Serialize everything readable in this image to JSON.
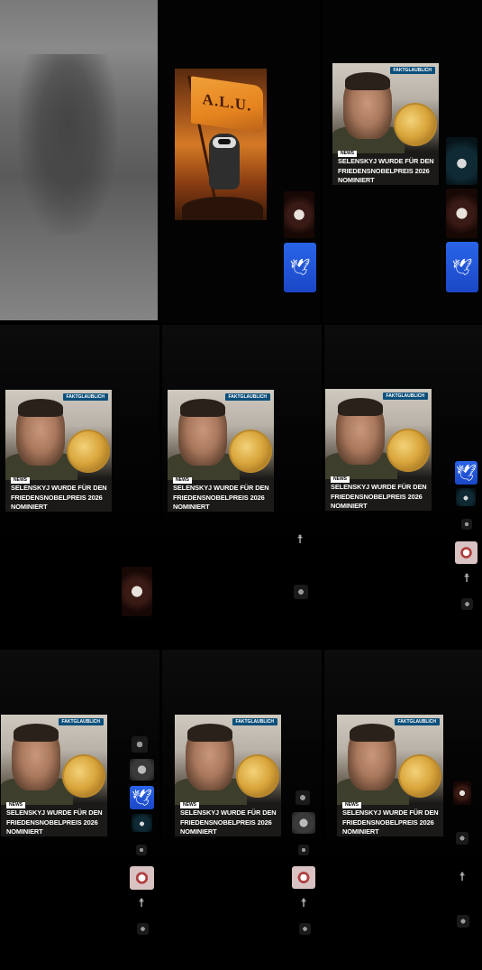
{
  "flag_post": {
    "flag_text": "A.L.U."
  },
  "post": {
    "brand": "FAKTGLAUBLICH",
    "tag": "NEWS",
    "headline_line1": "SELENSKYJ WURDE FÜR DEN",
    "headline_line2": "FRIEDENSNOBELPREIS 2026",
    "headline_line3": "NOMINIERT"
  },
  "icons": {
    "dove": "dove-icon",
    "figure": "person-icon",
    "group": "group-icon"
  }
}
